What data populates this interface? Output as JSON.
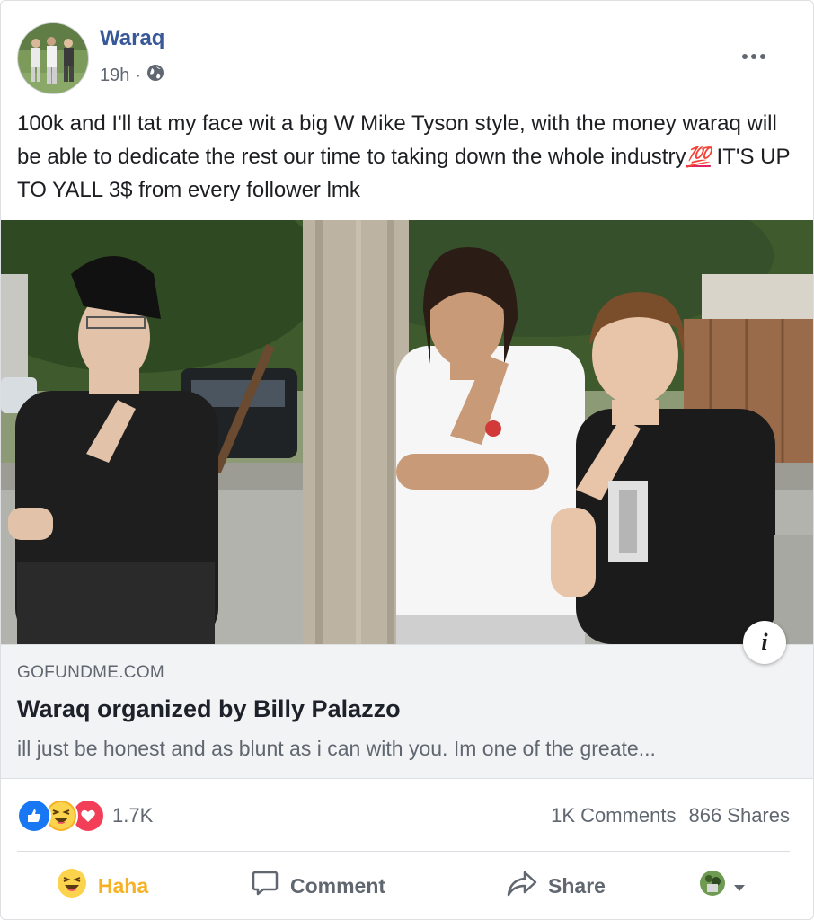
{
  "post": {
    "author": "Waraq",
    "time": "19h",
    "separator": "·",
    "privacy_icon": "globe-icon",
    "more_icon": "ellipsis-icon",
    "text_part1": "100k and I'll tat my face wit a big W Mike Tyson style, with the money waraq will be able to dedicate the rest our time to taking down the whole industry",
    "text_emoji": "💯",
    "text_part2": " IT'S UP TO YALL 3$ from every follower lmk"
  },
  "link_preview": {
    "domain": "GOFUNDME.COM",
    "title": "Waraq organized by Billy Palazzo",
    "description": "ill just be honest and as blunt as i can with you. Im one of the greate...",
    "info_label": "i"
  },
  "stats": {
    "reaction_icons": [
      "like-icon",
      "haha-icon",
      "love-icon"
    ],
    "reaction_count": "1.7K",
    "comments": "1K Comments",
    "shares": "866 Shares"
  },
  "actions": {
    "haha": "Haha",
    "comment": "Comment",
    "share": "Share"
  },
  "colors": {
    "author_link": "#385898",
    "haha_active": "#f7b125",
    "like_blue": "#1877f2",
    "love_red": "#f33e58",
    "secondary_text": "#606770",
    "link_box_bg": "#f2f3f5"
  }
}
